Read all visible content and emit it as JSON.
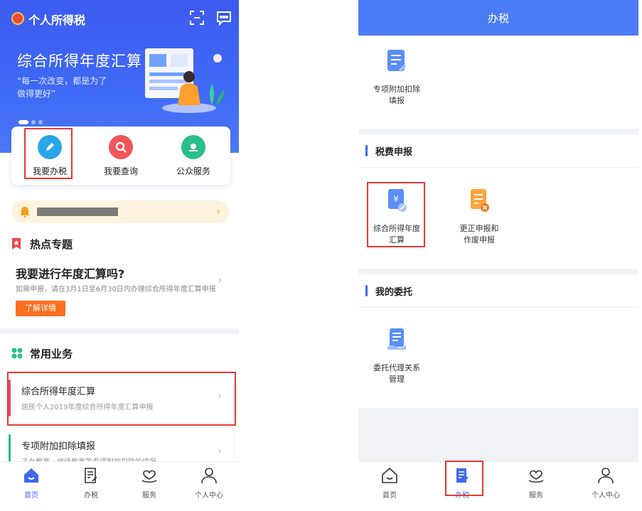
{
  "left": {
    "app_title": "个人所得税",
    "banner": {
      "title": "综合所得年度汇算",
      "quote_line1": "“每一次改变，都是为了",
      "quote_line2": "做得更好”"
    },
    "quick_actions": [
      {
        "label": "我要办税",
        "color": "#2aa6e8"
      },
      {
        "label": "我要查询",
        "color": "#f0555a"
      },
      {
        "label": "公众服务",
        "color": "#2bbf8c"
      }
    ],
    "hot": {
      "section_title": "热点专题",
      "headline": "我要进行年度汇算吗?",
      "subtitle": "如需申报，请在3月1日至6月30日内办理综合所得年度汇算申报",
      "button": "了解详情"
    },
    "common": {
      "section_title": "常用业务",
      "items": [
        {
          "title": "综合所得年度汇算",
          "subtitle": "居民个人2019年度综合所得年度汇算申报",
          "bar_color": "#e84c6a"
        },
        {
          "title": "专项附加扣除填报",
          "subtitle": "子女教育、继续教育等专项附加扣除的填报",
          "bar_color": "#2bbf8c"
        }
      ]
    },
    "tabs": [
      {
        "label": "首页",
        "active": true
      },
      {
        "label": "办税",
        "active": false
      },
      {
        "label": "服务",
        "active": false
      },
      {
        "label": "个人中心",
        "active": false
      }
    ]
  },
  "right": {
    "header_title": "办税",
    "top_item": {
      "line1": "专项附加扣除",
      "line2": "填报"
    },
    "section1": {
      "title": "税费申报",
      "items": [
        {
          "line1": "综合所得年度",
          "line2": "汇算"
        },
        {
          "line1": "更正申报和",
          "line2": "作废申报"
        }
      ]
    },
    "section2": {
      "title": "我的委托",
      "items": [
        {
          "line1": "委托代理关系",
          "line2": "管理"
        }
      ]
    },
    "tabs": [
      {
        "label": "首页",
        "active": false
      },
      {
        "label": "办税",
        "active": true
      },
      {
        "label": "服务",
        "active": false
      },
      {
        "label": "个人中心",
        "active": false
      }
    ]
  },
  "accent_color": "#3f67f0",
  "highlight_color": "#e53935"
}
